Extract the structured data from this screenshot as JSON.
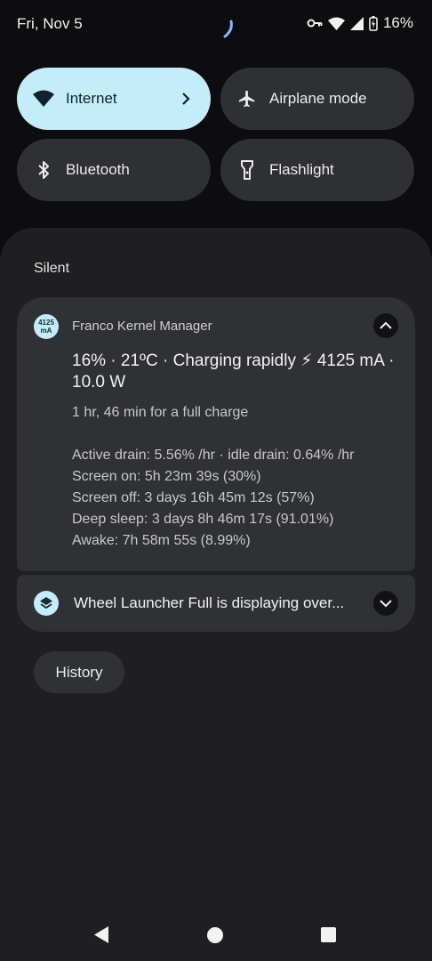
{
  "status_bar": {
    "date": "Fri, Nov 5",
    "battery_percent": "16%",
    "icons": [
      "vpn-key-icon",
      "wifi-icon",
      "cell-signal-icon",
      "battery-charging-icon"
    ]
  },
  "quick_settings": {
    "tiles": [
      {
        "label": "Internet",
        "icon": "wifi-icon",
        "active": true,
        "has_chevron": true
      },
      {
        "label": "Airplane mode",
        "icon": "airplane-icon",
        "active": false
      },
      {
        "label": "Bluetooth",
        "icon": "bluetooth-icon",
        "active": false
      },
      {
        "label": "Flashlight",
        "icon": "flashlight-icon",
        "active": false
      }
    ]
  },
  "notifications": {
    "section_label": "Silent",
    "kernel_manager": {
      "icon_line1": "4125",
      "icon_line2": "mA",
      "app_name": "Franco Kernel Manager",
      "title": "16% · 21ºC · Charging rapidly ⚡ 4125 mA · 10.0 W",
      "charge_time": "1 hr, 46 min for a full charge",
      "stats": [
        "Active drain: 5.56% /hr · idle drain: 0.64% /hr",
        "Screen on: 5h 23m 39s  (30%)",
        "Screen off: 3 days 16h 45m 12s  (57%)",
        "Deep sleep: 3 days 8h 46m 17s  (91.01%)",
        "Awake: 7h 58m 55s  (8.99%)"
      ]
    },
    "overlay": {
      "text": "Wheel Launcher Full is displaying over..."
    },
    "history_label": "History"
  },
  "colors": {
    "accent": "#c4ecfa",
    "tile_bg": "#2f3033",
    "shade_bg": "#1f1f21",
    "card_bg": "#303134"
  }
}
